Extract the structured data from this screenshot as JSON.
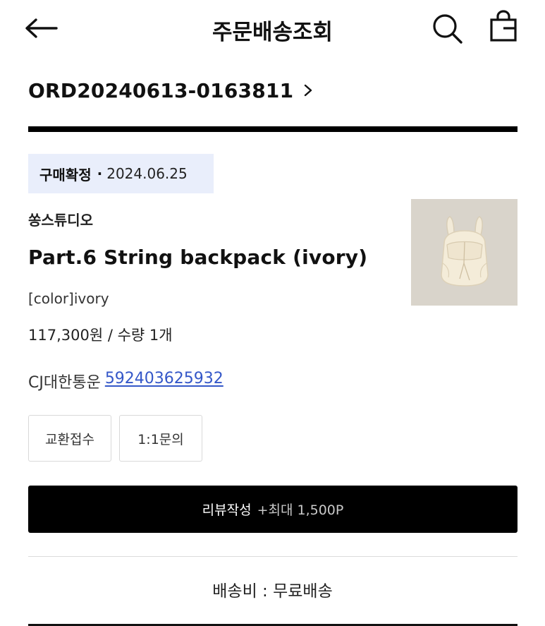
{
  "header": {
    "title": "주문배송조회",
    "back_icon": "arrow-left-icon",
    "search_icon": "search-icon",
    "bag_icon": "shopping-bag-icon"
  },
  "order": {
    "number": "ORD20240613-0163811",
    "chevron_icon": "chevron-right-icon"
  },
  "status": {
    "label": "구매확정",
    "dot": "·",
    "date": "2024.06.25",
    "badge_color": "#e9eefb"
  },
  "product": {
    "brand": "쏭스튜디오",
    "name": "Part.6 String backpack (ivory)",
    "option": "[color]ivory",
    "price": "117,300원 / 수량 1개",
    "thumbnail_icon": "backpack-image"
  },
  "delivery": {
    "carrier": "CJ대한통운",
    "tracking_number": "592403625932",
    "link_color": "#3457c8"
  },
  "actions": {
    "exchange_label": "교환접수",
    "inquiry_label": "1:1문의",
    "review_label": "리뷰작성",
    "review_bonus": "+최대 1,500P"
  },
  "shipping": {
    "fee_text": "배송비 : 무료배송"
  }
}
